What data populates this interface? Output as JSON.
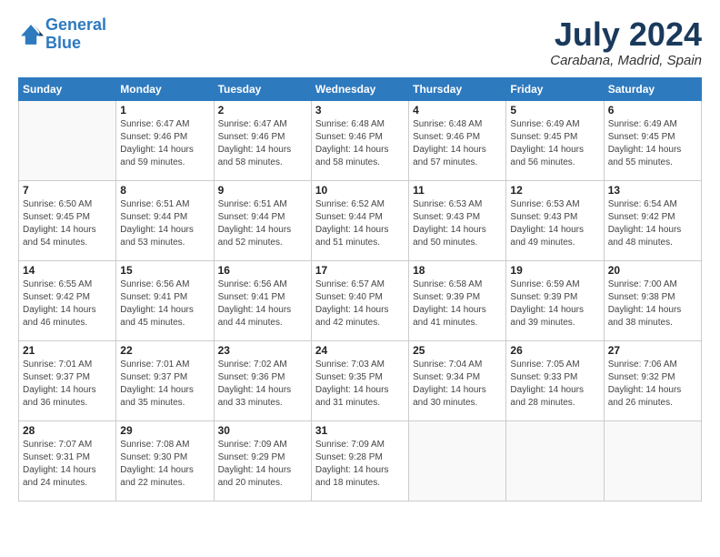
{
  "logo": {
    "line1": "General",
    "line2": "Blue"
  },
  "title": {
    "month_year": "July 2024",
    "location": "Carabana, Madrid, Spain"
  },
  "days_header": [
    "Sunday",
    "Monday",
    "Tuesday",
    "Wednesday",
    "Thursday",
    "Friday",
    "Saturday"
  ],
  "weeks": [
    [
      {
        "day": "",
        "info": ""
      },
      {
        "day": "1",
        "info": "Sunrise: 6:47 AM\nSunset: 9:46 PM\nDaylight: 14 hours\nand 59 minutes."
      },
      {
        "day": "2",
        "info": "Sunrise: 6:47 AM\nSunset: 9:46 PM\nDaylight: 14 hours\nand 58 minutes."
      },
      {
        "day": "3",
        "info": "Sunrise: 6:48 AM\nSunset: 9:46 PM\nDaylight: 14 hours\nand 58 minutes."
      },
      {
        "day": "4",
        "info": "Sunrise: 6:48 AM\nSunset: 9:46 PM\nDaylight: 14 hours\nand 57 minutes."
      },
      {
        "day": "5",
        "info": "Sunrise: 6:49 AM\nSunset: 9:45 PM\nDaylight: 14 hours\nand 56 minutes."
      },
      {
        "day": "6",
        "info": "Sunrise: 6:49 AM\nSunset: 9:45 PM\nDaylight: 14 hours\nand 55 minutes."
      }
    ],
    [
      {
        "day": "7",
        "info": "Sunrise: 6:50 AM\nSunset: 9:45 PM\nDaylight: 14 hours\nand 54 minutes."
      },
      {
        "day": "8",
        "info": "Sunrise: 6:51 AM\nSunset: 9:44 PM\nDaylight: 14 hours\nand 53 minutes."
      },
      {
        "day": "9",
        "info": "Sunrise: 6:51 AM\nSunset: 9:44 PM\nDaylight: 14 hours\nand 52 minutes."
      },
      {
        "day": "10",
        "info": "Sunrise: 6:52 AM\nSunset: 9:44 PM\nDaylight: 14 hours\nand 51 minutes."
      },
      {
        "day": "11",
        "info": "Sunrise: 6:53 AM\nSunset: 9:43 PM\nDaylight: 14 hours\nand 50 minutes."
      },
      {
        "day": "12",
        "info": "Sunrise: 6:53 AM\nSunset: 9:43 PM\nDaylight: 14 hours\nand 49 minutes."
      },
      {
        "day": "13",
        "info": "Sunrise: 6:54 AM\nSunset: 9:42 PM\nDaylight: 14 hours\nand 48 minutes."
      }
    ],
    [
      {
        "day": "14",
        "info": "Sunrise: 6:55 AM\nSunset: 9:42 PM\nDaylight: 14 hours\nand 46 minutes."
      },
      {
        "day": "15",
        "info": "Sunrise: 6:56 AM\nSunset: 9:41 PM\nDaylight: 14 hours\nand 45 minutes."
      },
      {
        "day": "16",
        "info": "Sunrise: 6:56 AM\nSunset: 9:41 PM\nDaylight: 14 hours\nand 44 minutes."
      },
      {
        "day": "17",
        "info": "Sunrise: 6:57 AM\nSunset: 9:40 PM\nDaylight: 14 hours\nand 42 minutes."
      },
      {
        "day": "18",
        "info": "Sunrise: 6:58 AM\nSunset: 9:39 PM\nDaylight: 14 hours\nand 41 minutes."
      },
      {
        "day": "19",
        "info": "Sunrise: 6:59 AM\nSunset: 9:39 PM\nDaylight: 14 hours\nand 39 minutes."
      },
      {
        "day": "20",
        "info": "Sunrise: 7:00 AM\nSunset: 9:38 PM\nDaylight: 14 hours\nand 38 minutes."
      }
    ],
    [
      {
        "day": "21",
        "info": "Sunrise: 7:01 AM\nSunset: 9:37 PM\nDaylight: 14 hours\nand 36 minutes."
      },
      {
        "day": "22",
        "info": "Sunrise: 7:01 AM\nSunset: 9:37 PM\nDaylight: 14 hours\nand 35 minutes."
      },
      {
        "day": "23",
        "info": "Sunrise: 7:02 AM\nSunset: 9:36 PM\nDaylight: 14 hours\nand 33 minutes."
      },
      {
        "day": "24",
        "info": "Sunrise: 7:03 AM\nSunset: 9:35 PM\nDaylight: 14 hours\nand 31 minutes."
      },
      {
        "day": "25",
        "info": "Sunrise: 7:04 AM\nSunset: 9:34 PM\nDaylight: 14 hours\nand 30 minutes."
      },
      {
        "day": "26",
        "info": "Sunrise: 7:05 AM\nSunset: 9:33 PM\nDaylight: 14 hours\nand 28 minutes."
      },
      {
        "day": "27",
        "info": "Sunrise: 7:06 AM\nSunset: 9:32 PM\nDaylight: 14 hours\nand 26 minutes."
      }
    ],
    [
      {
        "day": "28",
        "info": "Sunrise: 7:07 AM\nSunset: 9:31 PM\nDaylight: 14 hours\nand 24 minutes."
      },
      {
        "day": "29",
        "info": "Sunrise: 7:08 AM\nSunset: 9:30 PM\nDaylight: 14 hours\nand 22 minutes."
      },
      {
        "day": "30",
        "info": "Sunrise: 7:09 AM\nSunset: 9:29 PM\nDaylight: 14 hours\nand 20 minutes."
      },
      {
        "day": "31",
        "info": "Sunrise: 7:09 AM\nSunset: 9:28 PM\nDaylight: 14 hours\nand 18 minutes."
      },
      {
        "day": "",
        "info": ""
      },
      {
        "day": "",
        "info": ""
      },
      {
        "day": "",
        "info": ""
      }
    ]
  ]
}
